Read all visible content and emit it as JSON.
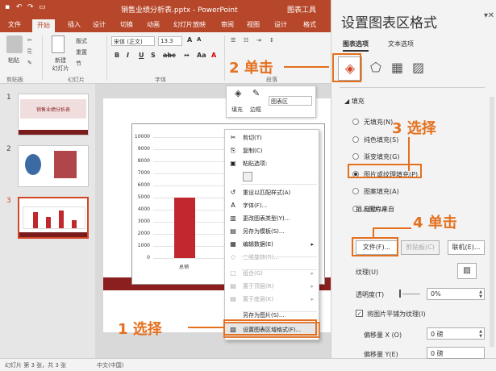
{
  "window": {
    "title": "销售业绩分析表.pptx - PowerPoint",
    "tool_tab": "图表工具"
  },
  "tabs": [
    "文件",
    "开始",
    "插入",
    "设计",
    "切换",
    "动画",
    "幻灯片放映",
    "审阅",
    "视图",
    "设计",
    "格式"
  ],
  "ribbon": {
    "paste": "粘贴",
    "clipboard": "剪贴板",
    "new_slide": "新建\n幻灯片",
    "layout": "版式",
    "reset": "重置",
    "section": "节",
    "slides_group": "幻灯片",
    "font_name": "宋体 (正文)",
    "font_size": "13.3",
    "font_group": "字体",
    "para_group": "段落"
  },
  "mini_toolbar": {
    "fill": "填充",
    "outline": "边框",
    "element": "图表区"
  },
  "slides": [
    {
      "num": "1",
      "title": "销售业绩分析表"
    },
    {
      "num": "2"
    },
    {
      "num": "3"
    }
  ],
  "chart_data": {
    "type": "bar",
    "categories": [
      "总销"
    ],
    "values": [
      5000
    ],
    "ylim": [
      0,
      10000
    ],
    "yticks": [
      "10000",
      "9000",
      "8000",
      "7000",
      "6000",
      "5000",
      "4000",
      "3000",
      "2000",
      "1000",
      "0"
    ],
    "title": "",
    "xlabel": "",
    "ylabel": ""
  },
  "context_menu": {
    "items": [
      {
        "label": "剪切(T)",
        "icon": "scissors-icon",
        "glyph": "✂",
        "enabled": true
      },
      {
        "label": "复制(C)",
        "icon": "copy-icon",
        "glyph": "⎘",
        "enabled": true
      },
      {
        "label": "粘贴选项:",
        "icon": "paste-icon",
        "glyph": "▣",
        "enabled": true
      },
      {
        "label": "",
        "icon": "",
        "glyph": "",
        "enabled": true
      },
      {
        "label": "重设以匹配样式(A)",
        "icon": "reset-style-icon",
        "glyph": "↺",
        "enabled": true
      },
      {
        "label": "字体(F)...",
        "icon": "font-icon",
        "glyph": "A",
        "enabled": true
      },
      {
        "label": "更改图表类型(Y)...",
        "icon": "chart-type-icon",
        "glyph": "▥",
        "enabled": true
      },
      {
        "label": "另存为模板(S)...",
        "icon": "template-icon",
        "glyph": "▤",
        "enabled": true
      },
      {
        "label": "编辑数据(E)",
        "icon": "edit-data-icon",
        "glyph": "▦",
        "enabled": true,
        "submenu": true
      },
      {
        "label": "三维旋转(R)...",
        "icon": "rotate-icon",
        "glyph": "◇",
        "enabled": false
      },
      {
        "label": "组合(G)",
        "icon": "group-icon",
        "glyph": "▢",
        "enabled": false,
        "submenu": true
      },
      {
        "label": "置于顶层(R)",
        "icon": "bring-front-icon",
        "glyph": "▤",
        "enabled": false,
        "submenu": true
      },
      {
        "label": "置于底层(K)",
        "icon": "send-back-icon",
        "glyph": "▤",
        "enabled": false,
        "submenu": true
      },
      {
        "label": "另存为图片(S)...",
        "icon": "",
        "glyph": "",
        "enabled": true
      },
      {
        "label": "设置图表区域格式(F)...",
        "icon": "format-area-icon",
        "glyph": "▧",
        "enabled": true,
        "highlight": true
      }
    ]
  },
  "panel": {
    "title": "设置图表区格式",
    "tab_chart_options": "图表选项",
    "tab_text_options": "文本选项",
    "section_fill": "填充",
    "fill_options": [
      {
        "label": "无填充(N)",
        "selected": false
      },
      {
        "label": "纯色填充(S)",
        "selected": false
      },
      {
        "label": "渐变填充(G)",
        "selected": false
      },
      {
        "label": "图片或纹理填充(P)",
        "selected": true
      },
      {
        "label": "图案填充(A)",
        "selected": false
      },
      {
        "label": "自动(U)",
        "selected": false
      }
    ],
    "insert_from": "插入图片来自",
    "file_button": "文件(F)...",
    "clipboard_button": "剪贴板(C)",
    "online_button": "联机(E)...",
    "texture_label": "纹理(U)",
    "transparency_label": "透明度(T)",
    "transparency_value": "0%",
    "tile_label": "将图片平铺为纹理(I)",
    "offset_x_label": "偏移量 X (O)",
    "offset_x_value": "0 磅",
    "offset_y_label": "偏移量 Y(E)",
    "offset_y_value": "0 磅"
  },
  "status": {
    "slide_info": "幻灯片 第 3 张，共 3 张",
    "language": "中文(中国)"
  },
  "annotations": {
    "step1": "1 选择",
    "step2": "2 单击",
    "step3": "3 选择",
    "step4": "4 单击"
  },
  "colors": {
    "accent": "#b7472a",
    "annotation": "#e4701e",
    "bar": "#c0282e"
  }
}
